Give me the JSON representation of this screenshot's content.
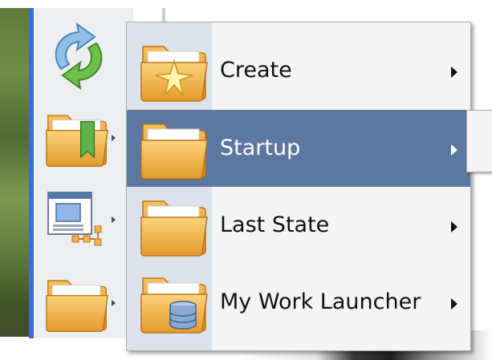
{
  "menu": {
    "items": [
      {
        "label": "Create",
        "icon": "folder-star-icon",
        "selected": false,
        "has_submenu": true
      },
      {
        "label": "Startup",
        "icon": "folder-icon",
        "selected": true,
        "has_submenu": true
      },
      {
        "label": "Last State",
        "icon": "folder-icon",
        "selected": false,
        "has_submenu": true
      },
      {
        "label": "My Work Launcher",
        "icon": "folder-database-icon",
        "selected": false,
        "has_submenu": true
      }
    ]
  },
  "toolbar": {
    "buttons": [
      {
        "icon": "refresh-icon",
        "has_dropdown": false
      },
      {
        "icon": "bookmark-folder-icon",
        "has_dropdown": true
      },
      {
        "icon": "window-layout-icon",
        "has_dropdown": true
      },
      {
        "icon": "folder-icon",
        "has_dropdown": true
      }
    ]
  },
  "colors": {
    "selection": "#5c77a0",
    "menu_background": "#f4f4f4",
    "gutter": "#dde2ea",
    "folder": "#f4b24a"
  }
}
